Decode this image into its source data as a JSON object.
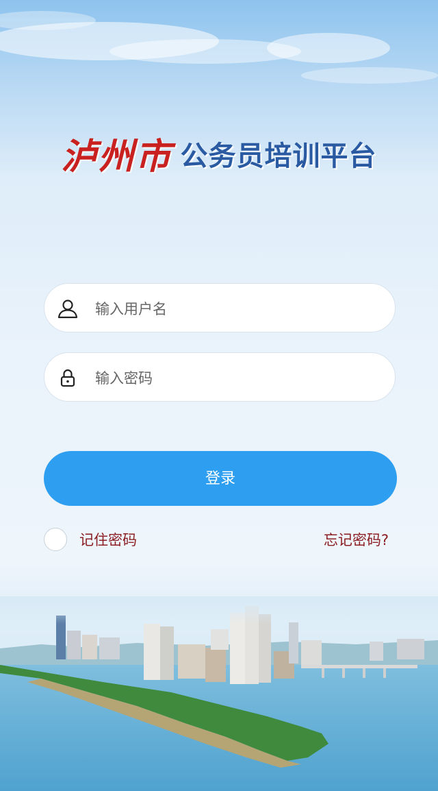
{
  "header": {
    "city_name": "泸州市",
    "platform_name": "公务员培训平台"
  },
  "form": {
    "username_placeholder": "输入用户名",
    "username_value": "",
    "password_placeholder": "输入密码",
    "password_value": "",
    "login_label": "登录",
    "remember_label": "记住密码",
    "remember_checked": false,
    "forgot_label": "忘记密码?"
  },
  "colors": {
    "city_name": "#c8211f",
    "platform_name": "#2a5aa2",
    "login_button": "#2d9ef0",
    "link_text": "#8b1f24"
  },
  "icons": [
    "user-icon",
    "lock-icon"
  ]
}
